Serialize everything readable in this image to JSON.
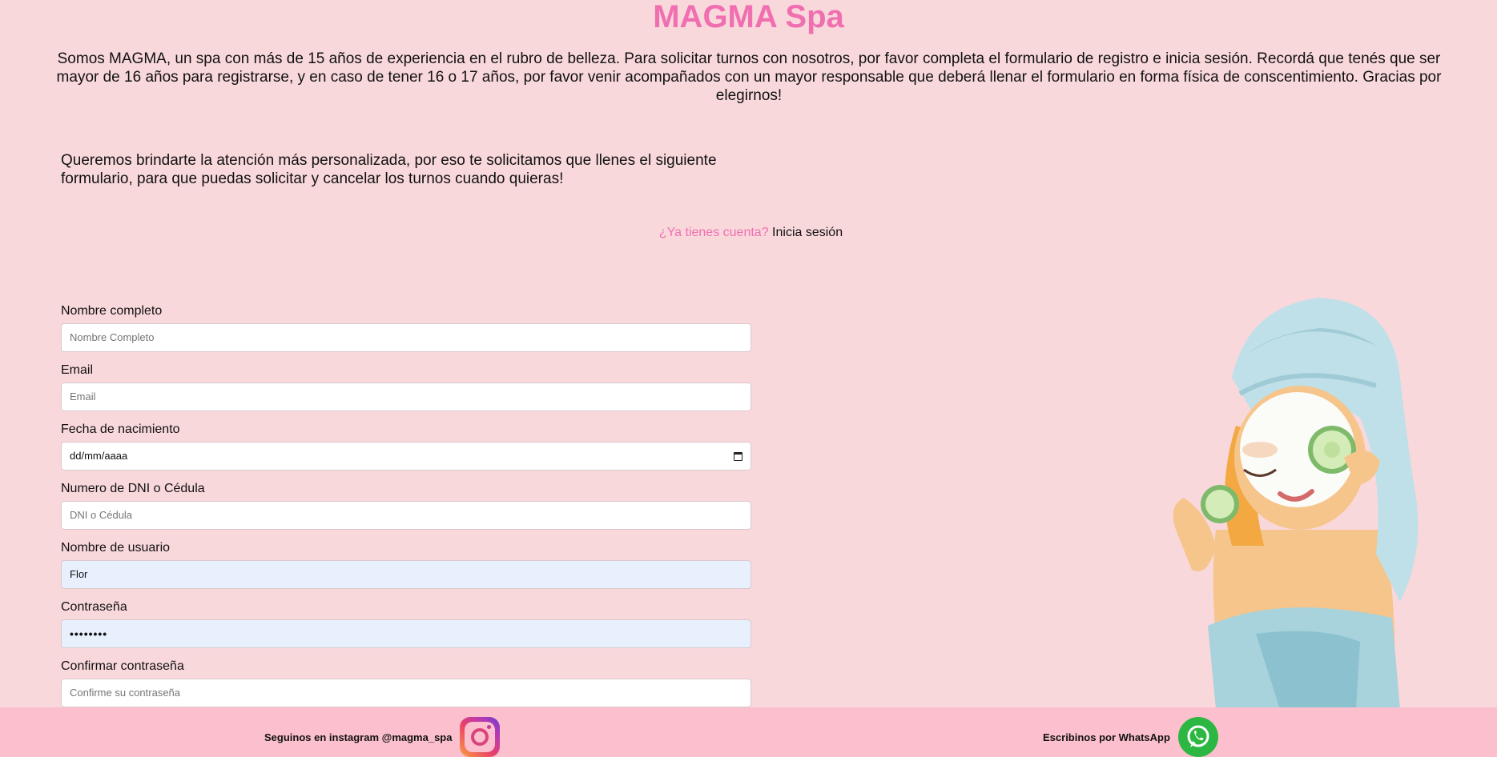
{
  "header": {
    "title": "MAGMA Spa"
  },
  "intro": {
    "text": "Somos MAGMA, un spa con más de 15 años de experiencia en el rubro de belleza. Para solicitar turnos con nosotros, por favor completa el formulario de registro e inicia sesión. Recordá que tenés que ser mayor de 16 años para registrarse, y en caso de tener 16 o 17 años, por favor venir acompañados con un mayor responsable que deberá llenar el formulario en forma física de conscentimiento. Gracias por elegirnos!"
  },
  "form_intro": {
    "text": "Queremos brindarte la atención más personalizada, por eso te solicitamos que llenes el siguiente formulario, para que puedas solicitar y cancelar los turnos cuando quieras!"
  },
  "account": {
    "question": "¿Ya tienes cuenta?",
    "link": "Inicia sesión"
  },
  "form": {
    "fields": [
      {
        "label": "Nombre completo",
        "placeholder": "Nombre Completo",
        "value": ""
      },
      {
        "label": "Email",
        "placeholder": "Email",
        "value": ""
      },
      {
        "label": "Fecha de nacimiento",
        "placeholder": "dd/mm/aaaa",
        "value": ""
      },
      {
        "label": "Numero de DNI o Cédula",
        "placeholder": "DNI o Cédula",
        "value": ""
      },
      {
        "label": "Nombre de usuario",
        "placeholder": "",
        "value": "Flor"
      },
      {
        "label": "Contraseña",
        "placeholder": "",
        "value": "••••••••"
      },
      {
        "label": "Confirmar contraseña",
        "placeholder": "Confirme su contraseña",
        "value": ""
      }
    ]
  },
  "footer": {
    "instagram_text": "Seguinos en instagram @magma_spa",
    "whatsapp_text": "Escribinos por WhatsApp"
  },
  "icons": {
    "instagram": "instagram-icon",
    "whatsapp": "whatsapp-icon",
    "calendar": "calendar-icon"
  },
  "colors": {
    "background": "#f9d8dc",
    "accent": "#f06fb0",
    "footer": "#fbbfcd",
    "autofill": "#e8f0fe",
    "whatsapp": "#2cb742"
  }
}
